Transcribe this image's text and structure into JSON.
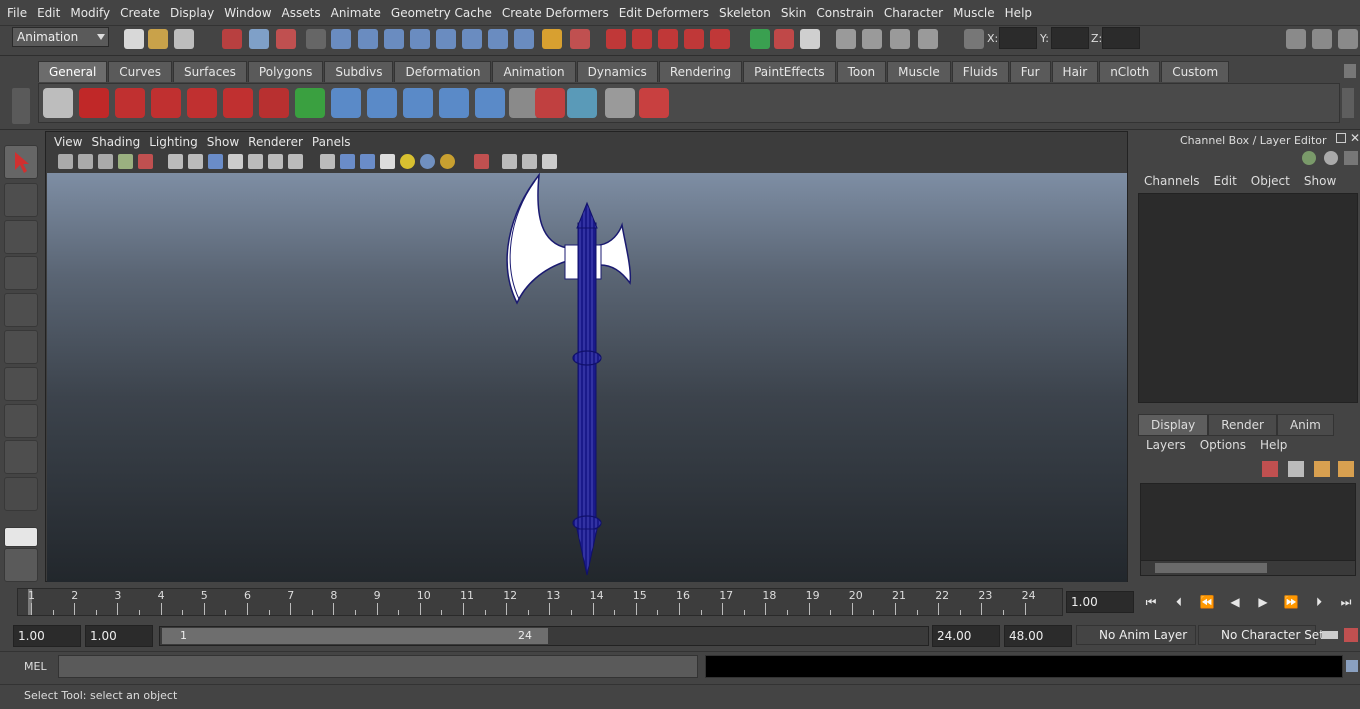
{
  "menubar": [
    "File",
    "Edit",
    "Modify",
    "Create",
    "Display",
    "Window",
    "Assets",
    "Animate",
    "Geometry Cache",
    "Create Deformers",
    "Edit Deformers",
    "Skeleton",
    "Skin",
    "Constrain",
    "Character",
    "Muscle",
    "Help"
  ],
  "status": {
    "menuset": "Animation",
    "x_label": "X:",
    "y_label": "Y:",
    "z_label": "Z:"
  },
  "shelf_tabs": [
    "General",
    "Curves",
    "Surfaces",
    "Polygons",
    "Subdivs",
    "Deformation",
    "Animation",
    "Dynamics",
    "Rendering",
    "PaintEffects",
    "Toon",
    "Muscle",
    "Fluids",
    "Fur",
    "Hair",
    "nCloth",
    "Custom"
  ],
  "shelf_active": "General",
  "viewport_menu": [
    "View",
    "Shading",
    "Lighting",
    "Show",
    "Renderer",
    "Panels"
  ],
  "channelbox": {
    "title": "Channel Box / Layer Editor",
    "menu": [
      "Channels",
      "Edit",
      "Object",
      "Show"
    ],
    "layer_tabs": [
      "Display",
      "Render",
      "Anim"
    ],
    "layer_menu": [
      "Layers",
      "Options",
      "Help"
    ]
  },
  "timeline": {
    "frames": [
      "1",
      "2",
      "3",
      "4",
      "5",
      "6",
      "7",
      "8",
      "9",
      "10",
      "11",
      "12",
      "13",
      "14",
      "15",
      "16",
      "17",
      "18",
      "19",
      "20",
      "21",
      "22",
      "23",
      "24"
    ],
    "current": "1.00"
  },
  "range": {
    "start": "1.00",
    "start2": "1.00",
    "slider_start": "1",
    "slider_end": "24",
    "end": "24.00",
    "end2": "48.00",
    "anim_layer": "No Anim Layer",
    "char_set": "No Character Set"
  },
  "cmd": {
    "label": "MEL"
  },
  "help": {
    "text": "Select Tool: select an object"
  }
}
